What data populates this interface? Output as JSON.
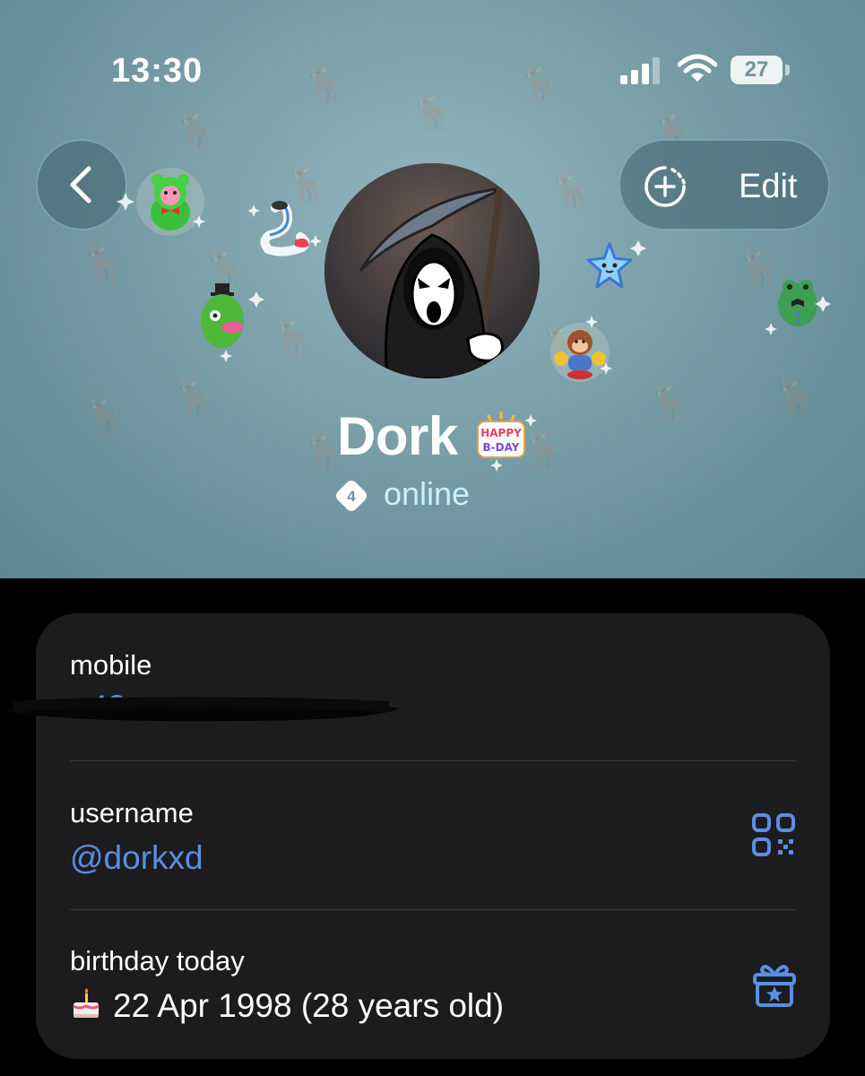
{
  "status_bar": {
    "time": "13:30",
    "battery": "27"
  },
  "header": {
    "back_icon": "chevron-left-icon",
    "edit_label": "Edit",
    "edit_icon": "add-story-icon",
    "name": "Dork",
    "boost_level": "4",
    "status": "online",
    "colors": {
      "background": "#7ea3ad",
      "status_text": "#c8f2f8"
    }
  },
  "info": {
    "mobile": {
      "label": "mobile",
      "value": "+43"
    },
    "username": {
      "label": "username",
      "value": "@dorkxd",
      "icon": "qr-code-icon"
    },
    "birthday": {
      "label": "birthday today",
      "value": "22 Apr 1998 (28 years old)",
      "icon": "gift-icon",
      "emoji": "cake-icon"
    },
    "colors": {
      "card": "#1c1c1e",
      "link": "#5b8ee2"
    }
  }
}
